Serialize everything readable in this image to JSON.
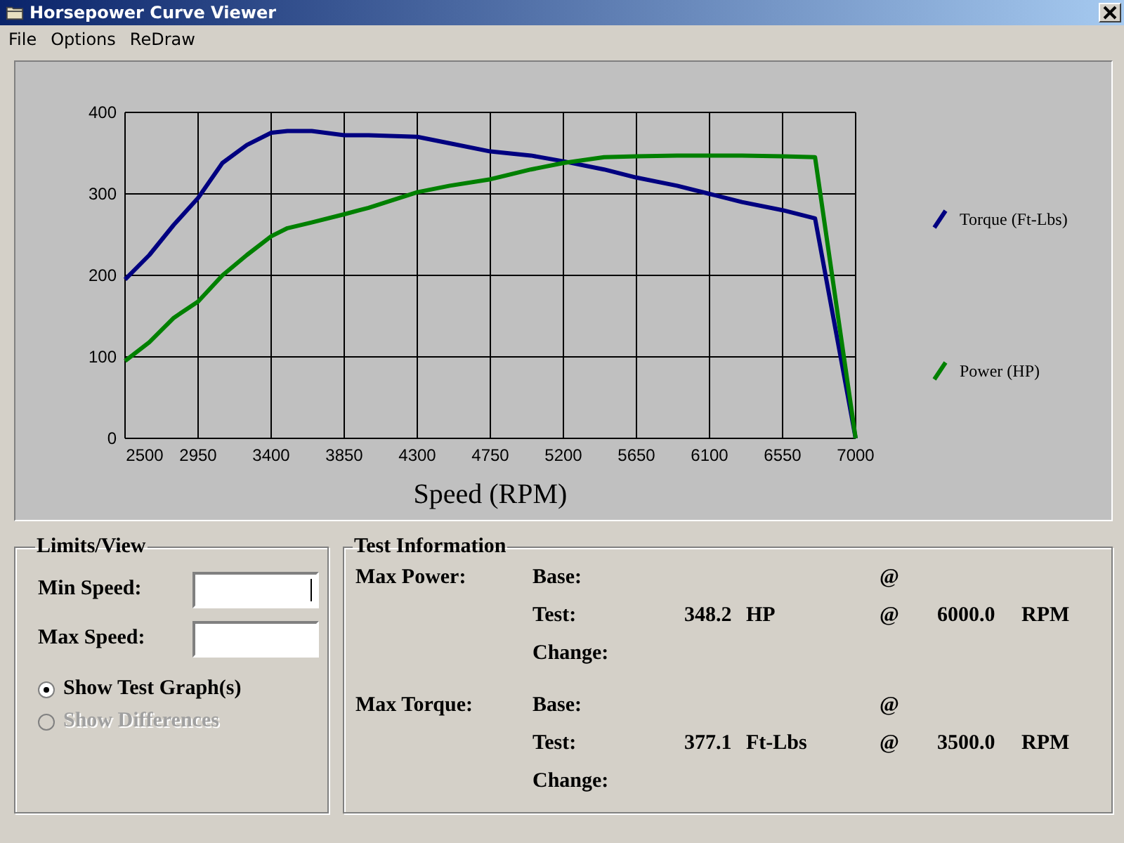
{
  "window": {
    "title": "Horsepower Curve Viewer"
  },
  "menu": [
    {
      "label": "File"
    },
    {
      "label": "Options"
    },
    {
      "label": "ReDraw"
    }
  ],
  "chart": {
    "chart_data": {
      "type": "line",
      "xlabel": "Speed (RPM)",
      "x": [
        2500,
        2650,
        2800,
        2950,
        3100,
        3250,
        3400,
        3500,
        3650,
        3850,
        4000,
        4300,
        4500,
        4750,
        5000,
        5200,
        5450,
        5650,
        5900,
        6100,
        6300,
        6550,
        6750,
        7000
      ],
      "series": [
        {
          "name": "Torque (Ft-Lbs)",
          "color": "#000080",
          "values": [
            195,
            225,
            262,
            295,
            338,
            360,
            375,
            377,
            377,
            372,
            372,
            370,
            362,
            352,
            347,
            340,
            330,
            320,
            310,
            300,
            290,
            280,
            270,
            0
          ]
        },
        {
          "name": "Power (HP)",
          "color": "#008000",
          "values": [
            95,
            118,
            148,
            168,
            200,
            225,
            248,
            258,
            265,
            275,
            283,
            302,
            310,
            318,
            330,
            338,
            345,
            346,
            347,
            347,
            347,
            346,
            345,
            0
          ]
        }
      ],
      "xlim": [
        2500,
        7000
      ],
      "ylim": [
        0,
        400
      ],
      "xticks": [
        2500,
        2950,
        3400,
        3850,
        4300,
        4750,
        5200,
        5650,
        6100,
        6550,
        7000
      ],
      "yticks": [
        0,
        100,
        200,
        300,
        400
      ],
      "grid": true,
      "legend": true
    }
  },
  "limits_view": {
    "title": "Limits/View",
    "fields": [
      {
        "label": "Min Speed:",
        "focused": true
      },
      {
        "label": "Max Speed:",
        "focused": false
      }
    ],
    "options": [
      {
        "label": "Show Test Graph(s)",
        "selected": true,
        "disabled": false
      },
      {
        "label": "Show Differences",
        "selected": false,
        "disabled": true
      }
    ]
  },
  "test_information": {
    "title": "Test Information",
    "sections": [
      {
        "label": "Max Power:",
        "rows": [
          {
            "label": "Base:",
            "at": "@"
          },
          {
            "label": "Test:",
            "value": "348.2",
            "unit": "HP",
            "at": "@",
            "speed": "6000.0",
            "speed_unit": "RPM"
          },
          {
            "label": "Change:"
          }
        ]
      },
      {
        "label": "Max Torque:",
        "rows": [
          {
            "label": "Base:",
            "at": "@"
          },
          {
            "label": "Test:",
            "value": "377.1",
            "unit": "Ft-Lbs",
            "at": "@",
            "speed": "3500.0",
            "speed_unit": "RPM"
          },
          {
            "label": "Change:"
          }
        ]
      }
    ]
  }
}
